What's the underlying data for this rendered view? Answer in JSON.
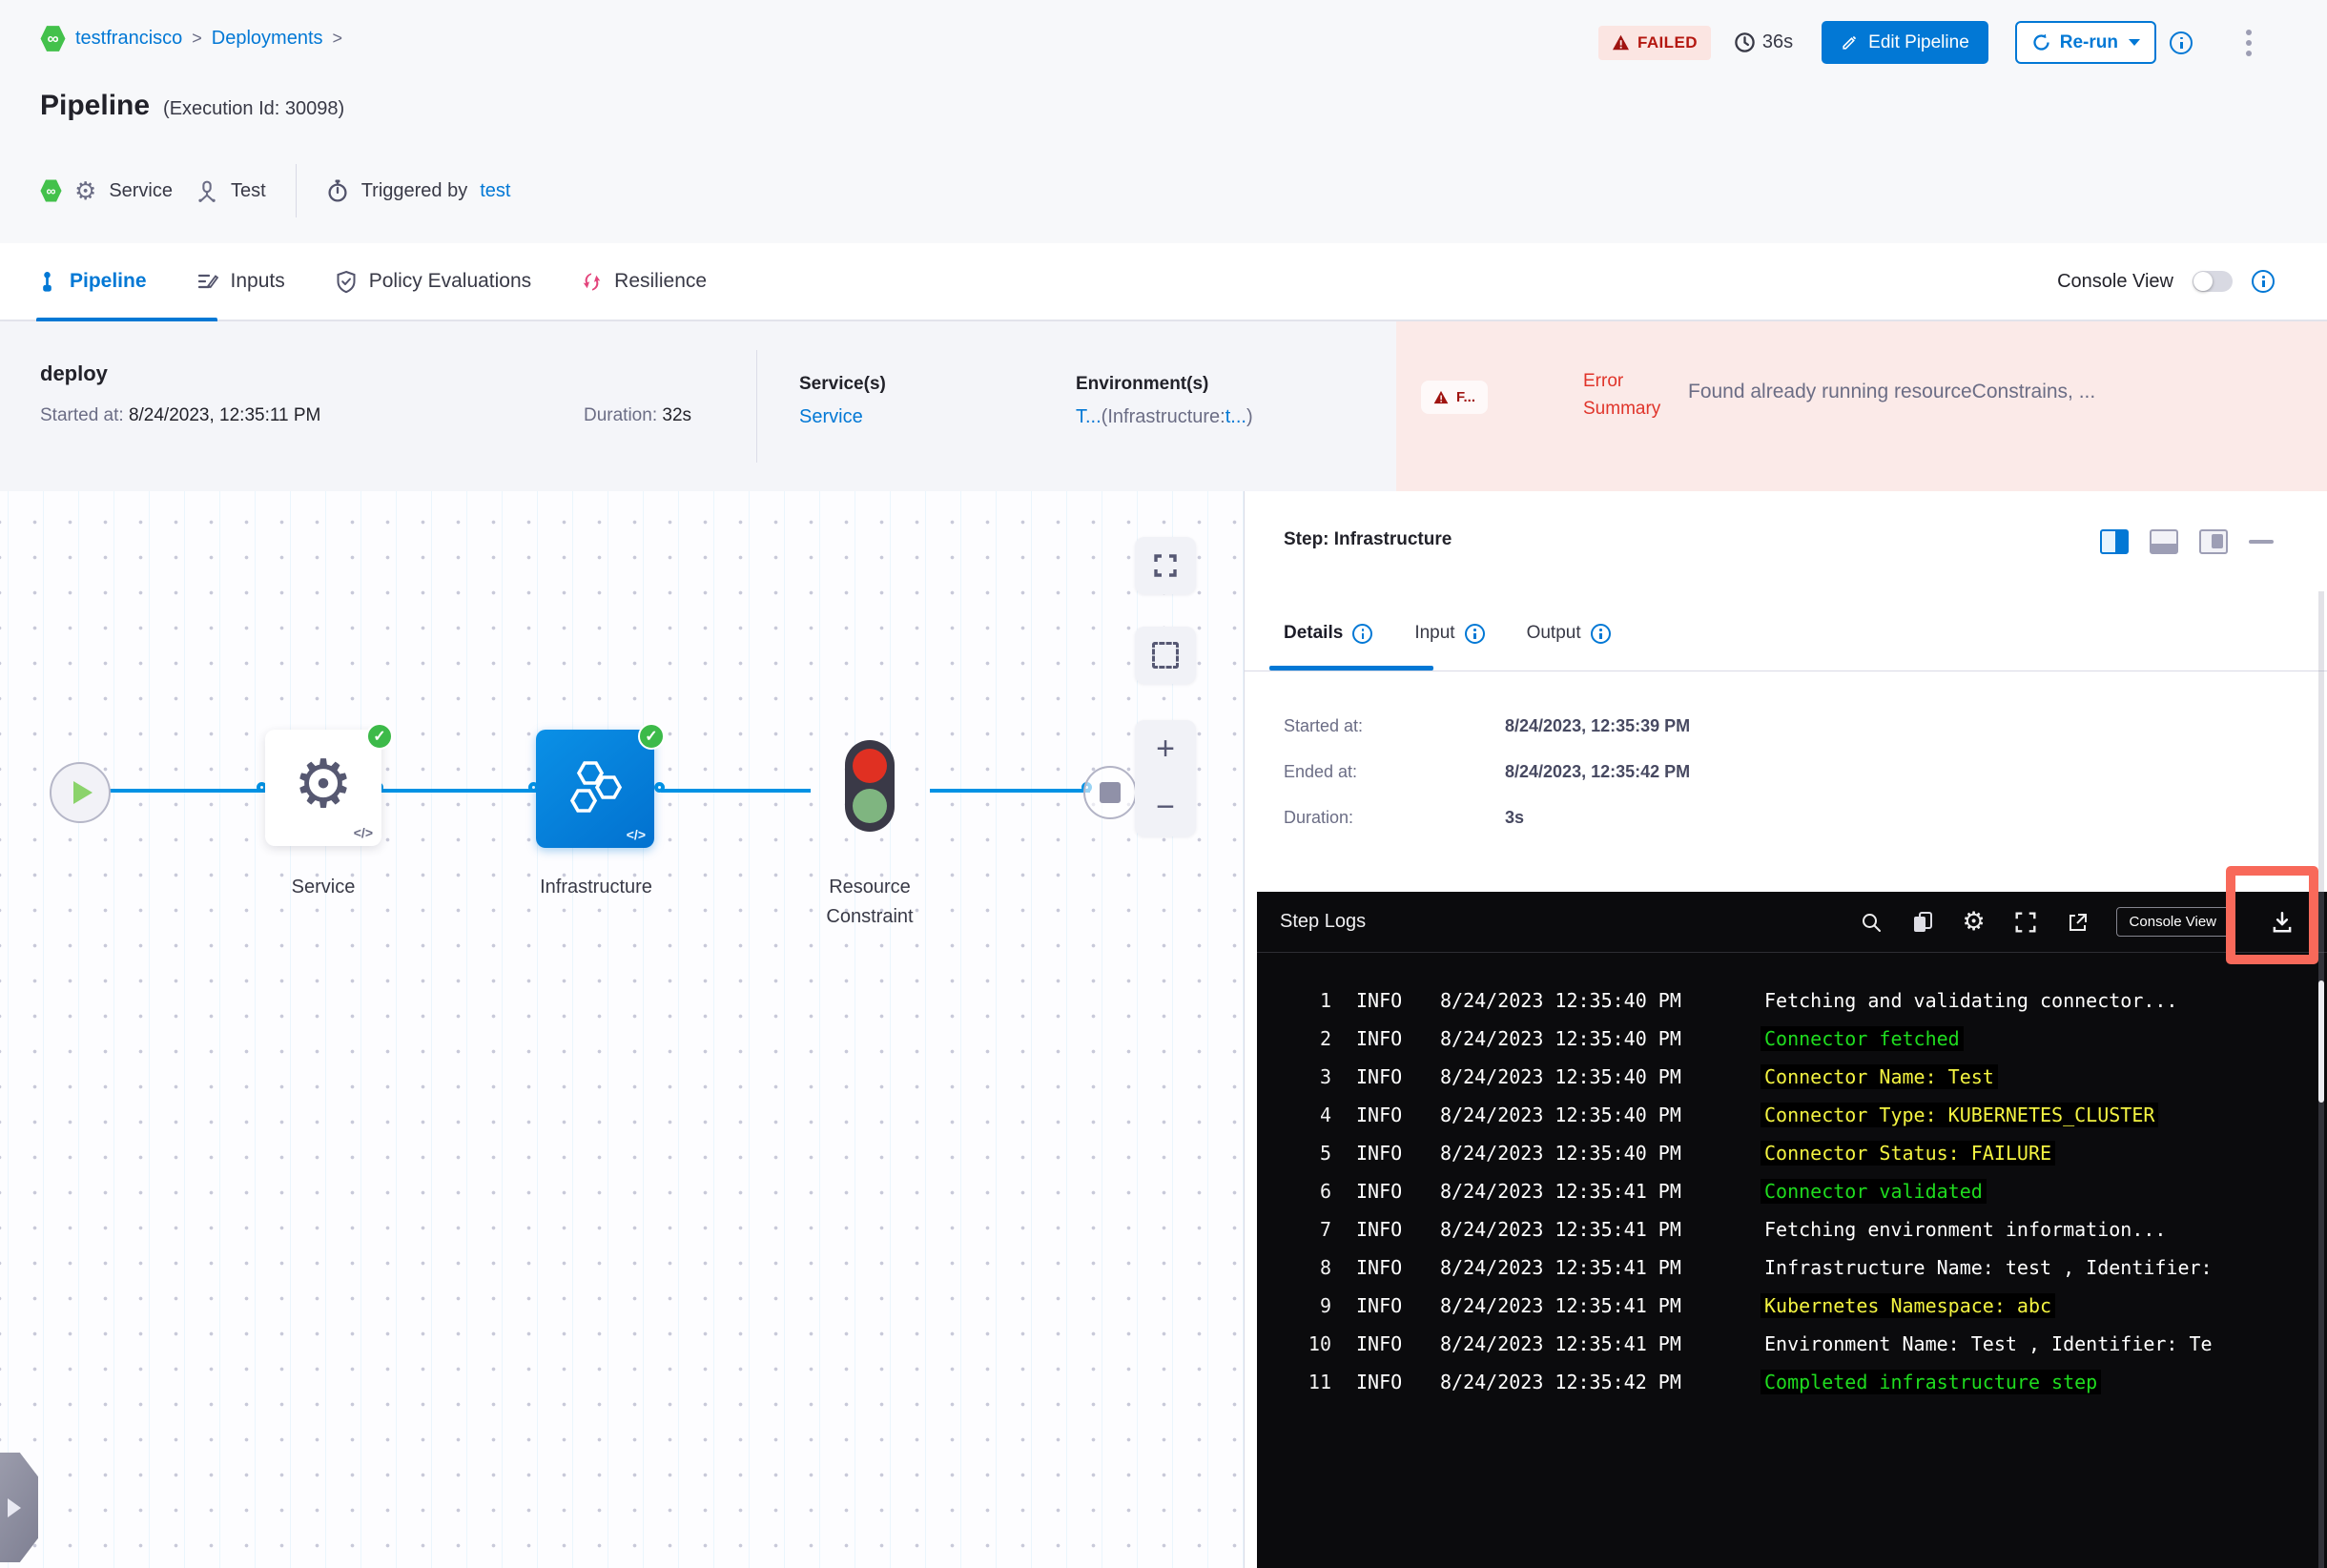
{
  "breadcrumb": {
    "project": "testfrancisco",
    "section": "Deployments",
    "separator": ">"
  },
  "header": {
    "title": "Pipeline",
    "subtitle": "(Execution Id: 30098)",
    "status_badge": "FAILED",
    "elapsed": "36s",
    "edit_button": "Edit Pipeline",
    "rerun_button": "Re-run",
    "service_label": "Service",
    "environment_label": "Test",
    "triggered_by_label": "Triggered by",
    "triggered_by_user": "test"
  },
  "tabs": {
    "pipeline": "Pipeline",
    "inputs": "Inputs",
    "policy": "Policy Evaluations",
    "resilience": "Resilience",
    "console_view_label": "Console View"
  },
  "stage": {
    "name": "deploy",
    "started_label": "Started at:",
    "started_value": "8/24/2023, 12:35:11 PM",
    "duration_label": "Duration:",
    "duration_value": "32s",
    "services_label": "Service(s)",
    "services_value": "Service",
    "environments_label": "Environment(s)",
    "env_link1": "T...",
    "env_mid": "(Infrastructure:",
    "env_link2": "t...",
    "env_end": ")",
    "error_chip": "F...",
    "error_label": "Error Summary",
    "error_message": "Found already running resourceConstrains, ..."
  },
  "canvas": {
    "node_service": "Service",
    "node_infrastructure": "Infrastructure",
    "node_resource_constraint": "Resource Constraint",
    "zoom_in": "+",
    "zoom_out": "−"
  },
  "step_panel": {
    "title": "Step: Infrastructure",
    "tab_details": "Details",
    "tab_input": "Input",
    "tab_output": "Output",
    "rows": [
      {
        "label": "Started at:",
        "value": "8/24/2023, 12:35:39 PM"
      },
      {
        "label": "Ended at:",
        "value": "8/24/2023, 12:35:42 PM"
      },
      {
        "label": "Duration:",
        "value": "3s"
      }
    ]
  },
  "step_logs": {
    "title": "Step Logs",
    "console_view_button": "Console View",
    "lines": [
      {
        "num": "1",
        "level": "INFO",
        "time": "8/24/2023 12:35:40 PM",
        "msg": "Fetching and validating connector...",
        "color": "white"
      },
      {
        "num": "2",
        "level": "INFO",
        "time": "8/24/2023 12:35:40 PM",
        "msg": "Connector fetched",
        "color": "green"
      },
      {
        "num": "3",
        "level": "INFO",
        "time": "8/24/2023 12:35:40 PM",
        "msg": "Connector Name: Test",
        "color": "yellow"
      },
      {
        "num": "4",
        "level": "INFO",
        "time": "8/24/2023 12:35:40 PM",
        "msg": "Connector Type: KUBERNETES_CLUSTER",
        "color": "yellow"
      },
      {
        "num": "5",
        "level": "INFO",
        "time": "8/24/2023 12:35:40 PM",
        "msg": "Connector Status: FAILURE",
        "color": "yellow"
      },
      {
        "num": "6",
        "level": "INFO",
        "time": "8/24/2023 12:35:41 PM",
        "msg": "Connector validated",
        "color": "green"
      },
      {
        "num": "7",
        "level": "INFO",
        "time": "8/24/2023 12:35:41 PM",
        "msg": "Fetching environment information...",
        "color": "white"
      },
      {
        "num": "8",
        "level": "INFO",
        "time": "8/24/2023 12:35:41 PM",
        "msg": "Infrastructure Name: test , Identifier:",
        "color": "white"
      },
      {
        "num": "9",
        "level": "INFO",
        "time": "8/24/2023 12:35:41 PM",
        "msg": "Kubernetes Namespace: abc",
        "color": "yellow"
      },
      {
        "num": "10",
        "level": "INFO",
        "time": "8/24/2023 12:35:41 PM",
        "msg": "Environment Name: Test , Identifier: Te",
        "color": "white"
      },
      {
        "num": "11",
        "level": "INFO",
        "time": "8/24/2023 12:35:42 PM",
        "msg": "Completed infrastructure step",
        "color": "green"
      }
    ]
  },
  "colors": {
    "accent_blue": "#0278d5",
    "edge_blue": "#0092e4",
    "failed_red": "#b41710",
    "error_bg": "#fbeae8",
    "success_green": "#3cba49",
    "log_green": "#1fdc1f",
    "log_yellow": "#f3f341",
    "annotation": "#f8695a"
  }
}
